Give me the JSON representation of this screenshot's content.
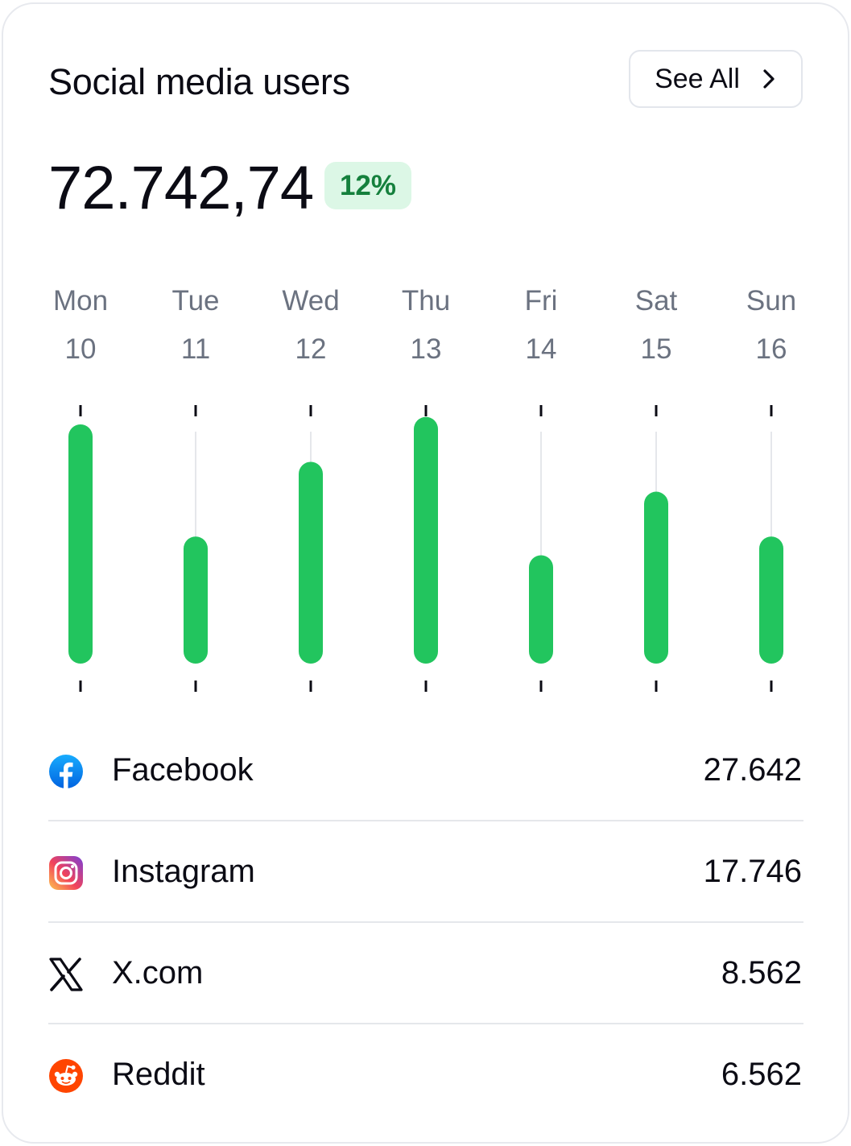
{
  "header": {
    "title": "Social media users",
    "see_all_label": "See All"
  },
  "summary": {
    "total": "72.742,74",
    "change_badge": "12%"
  },
  "colors": {
    "bar": "#22c55e",
    "badge_bg": "#dcf7e6",
    "badge_text": "#15803d",
    "track": "#e5e7eb"
  },
  "chart_data": {
    "type": "bar",
    "categories": [
      "Mon 10",
      "Tue 11",
      "Wed 12",
      "Thu 13",
      "Fri 14",
      "Sat 15",
      "Sun 16"
    ],
    "day_names": [
      "Mon",
      "Tue",
      "Wed",
      "Thu",
      "Fri",
      "Sat",
      "Sun"
    ],
    "day_numbers": [
      "10",
      "11",
      "12",
      "13",
      "14",
      "15",
      "16"
    ],
    "values": [
      0.64,
      0.34,
      0.54,
      0.66,
      0.29,
      0.46,
      0.34
    ],
    "ylim": [
      0,
      1
    ],
    "grid": false
  },
  "platforms": [
    {
      "name": "Facebook",
      "value": "27.642",
      "icon": "facebook-icon"
    },
    {
      "name": "Instagram",
      "value": "17.746",
      "icon": "instagram-icon"
    },
    {
      "name": "X.com",
      "value": "8.562",
      "icon": "x-icon"
    },
    {
      "name": "Reddit",
      "value": "6.562",
      "icon": "reddit-icon"
    }
  ]
}
